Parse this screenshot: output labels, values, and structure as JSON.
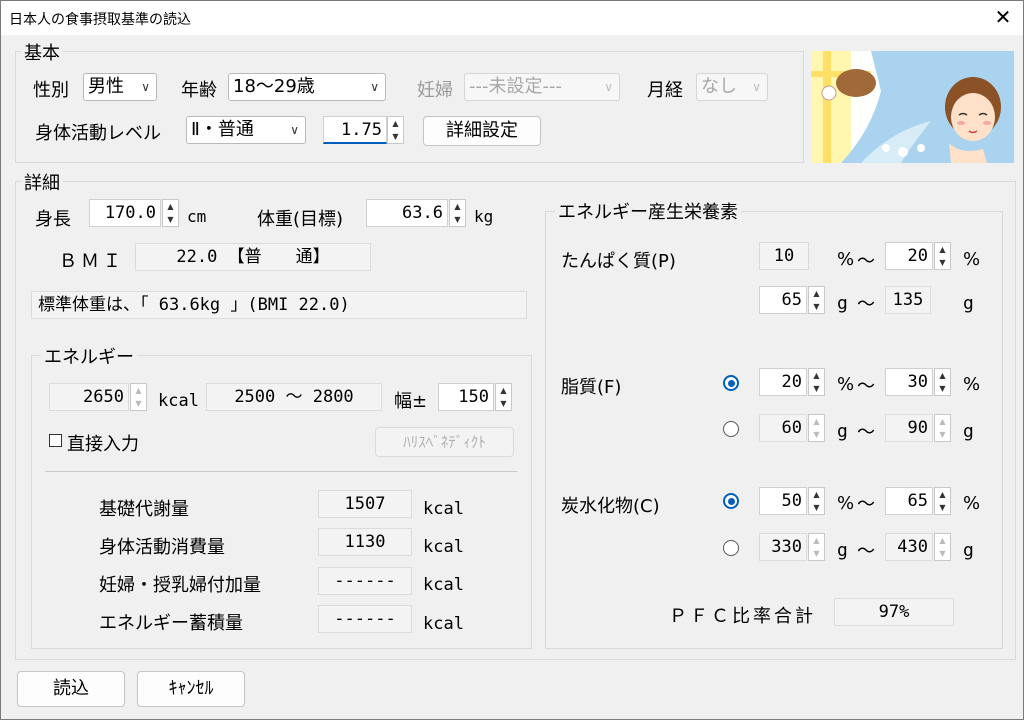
{
  "window": {
    "title": "日本人の食事摂取基準の読込",
    "close_glyph": "✕"
  },
  "basic": {
    "legend": "基本",
    "sex_label": "性別",
    "sex_value": "男性",
    "age_label": "年齢",
    "age_value": "18〜29歳",
    "pregnant_label": "妊婦",
    "pregnant_value": "---未設定---",
    "menses_label": "月経",
    "menses_value": "なし",
    "activity_label": "身体活動レベル",
    "activity_value": "Ⅱ・普通",
    "activity_factor": "1.75",
    "detail_button": "詳細設定"
  },
  "detail": {
    "legend": "詳細",
    "height_label": "身長",
    "height_value": "170.0",
    "height_unit": "cm",
    "weight_label": "体重(目標)",
    "weight_value": "63.6",
    "weight_unit": "kg",
    "bmi_label": "ＢＭＩ",
    "bmi_value": "22.0 【普　　通】",
    "standard_weight_text": "標準体重は、「 63.6kg 」(BMI 22.0)"
  },
  "energy": {
    "legend": "エネルギー",
    "kcal_value": "2650",
    "kcal_unit": "kcal",
    "range_text": "2500 〜 2800",
    "width_label": "幅±",
    "width_value": "150",
    "direct_input_label": "直接入力",
    "harris_button": "ﾊﾘｽﾍﾞﾈﾃﾞｨｸﾄ",
    "rows": [
      {
        "label": "基礎代謝量",
        "value": "1507",
        "unit": "kcal"
      },
      {
        "label": "身体活動消費量",
        "value": "1130",
        "unit": "kcal"
      },
      {
        "label": "妊婦・授乳婦付加量",
        "value": "------",
        "unit": "kcal"
      },
      {
        "label": "エネルギー蓄積量",
        "value": "------",
        "unit": "kcal"
      }
    ]
  },
  "pfc": {
    "legend": "エネルギー産生栄養素",
    "protein_label": "たんぱく質(P)",
    "protein_pct_min": "10",
    "protein_pct_max": "20",
    "protein_g_min": "65",
    "protein_g_max": "135",
    "fat_label": "脂質(F)",
    "fat_pct_min": "20",
    "fat_pct_max": "30",
    "fat_g_min": "60",
    "fat_g_max": "90",
    "carb_label": "炭水化物(C)",
    "carb_pct_min": "50",
    "carb_pct_max": "65",
    "carb_g_min": "330",
    "carb_g_max": "430",
    "unit_pct": "%",
    "unit_g": "g",
    "tilde": "〜",
    "total_label": "ＰＦＣ比率合計",
    "total_value": "97%"
  },
  "footer": {
    "load_button": "読込",
    "cancel_button": "ｷｬﾝｾﾙ"
  },
  "colors": {
    "accent": "#005fb8",
    "sky": "#a9d3ee",
    "window_bg": "#f0f0f0"
  }
}
